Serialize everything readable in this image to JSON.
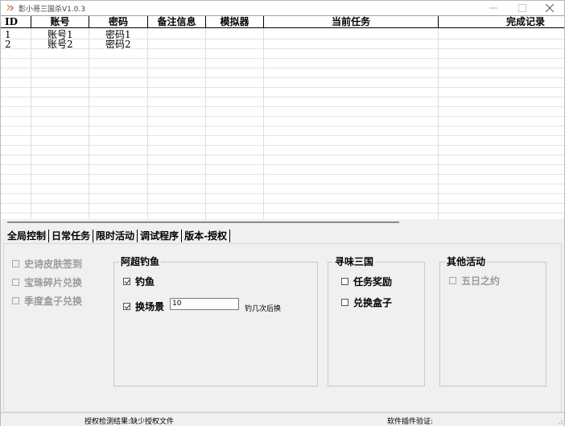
{
  "window": {
    "title": "影小哥三国杀V1.0.3"
  },
  "titlebar_buttons": {
    "minimize": "minimize-icon",
    "maximize": "maximize-icon",
    "close": "close-icon"
  },
  "grid": {
    "columns": [
      "ID",
      "账号",
      "密码",
      "备注信息",
      "模拟器",
      "当前任务",
      "完成记录"
    ],
    "rows": [
      {
        "id": "1",
        "account": "账号1",
        "password": "密码1",
        "note": "",
        "emulator": "",
        "task": "",
        "record": ""
      },
      {
        "id": "2",
        "account": "账号2",
        "password": "密码2",
        "note": "",
        "emulator": "",
        "task": "",
        "record": ""
      }
    ]
  },
  "tabs": [
    {
      "label": "全局控制"
    },
    {
      "label": "日常任务"
    },
    {
      "label": "限时活动",
      "active": true
    },
    {
      "label": "调试程序"
    },
    {
      "label": "版本-授权"
    }
  ],
  "left_options": [
    {
      "label": "史诗皮肤签到",
      "checked": false,
      "enabled": false
    },
    {
      "label": "宝珠碎片兑换",
      "checked": false,
      "enabled": false
    },
    {
      "label": "季度盒子兑换",
      "checked": false,
      "enabled": false
    }
  ],
  "fishing": {
    "title": "阿超钓鱼",
    "fish_label": "钓鱼",
    "fish_checked": true,
    "switch_label": "换场景",
    "switch_checked": true,
    "switch_value": "10",
    "switch_hint": "钓几次后换"
  },
  "xunwei": {
    "title": "寻味三国",
    "task_reward_label": "任务奖励",
    "task_reward_checked": false,
    "exchange_box_label": "兑换盒子",
    "exchange_box_checked": false
  },
  "other": {
    "title": "其他活动",
    "five_days_label": "五日之约",
    "five_days_checked": false,
    "five_days_enabled": false
  },
  "status": {
    "auth_result": "授权检测结果:缺少授权文件",
    "plugin_verify": "软件插件验证:"
  },
  "colors": {
    "title_icon": "#e0a030",
    "grid_line": "#dcdcdc",
    "disabled_text": "#9a9a9a"
  }
}
